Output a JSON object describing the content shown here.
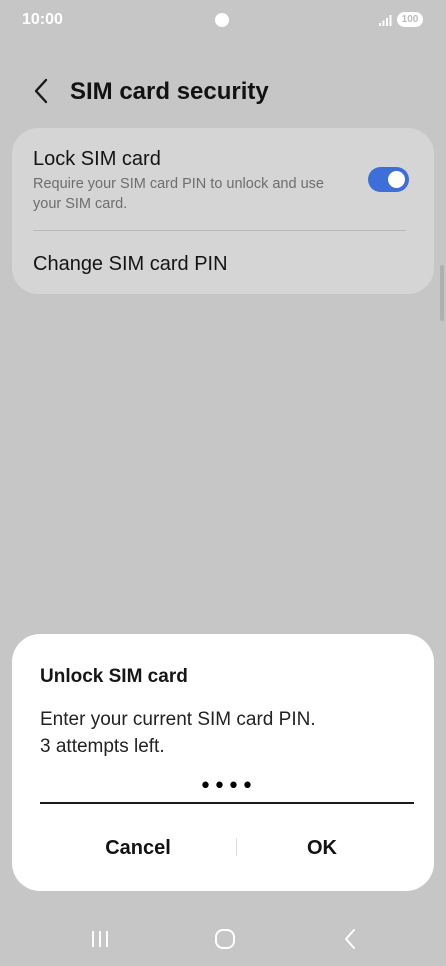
{
  "status_bar": {
    "time": "10:00",
    "battery": "100"
  },
  "header": {
    "title": "SIM card security"
  },
  "settings": {
    "lock_sim": {
      "title": "Lock SIM card",
      "description": "Require your SIM card PIN to unlock and use your SIM card.",
      "enabled": true
    },
    "change_pin": {
      "label": "Change SIM card PIN"
    }
  },
  "dialog": {
    "title": "Unlock SIM card",
    "message_line1": "Enter your current SIM card PIN.",
    "message_line2": "3 attempts left.",
    "pin_value": "••••",
    "cancel_label": "Cancel",
    "ok_label": "OK"
  },
  "colors": {
    "accent": "#3e6fd9",
    "dim_background": "#c6c6c6",
    "card": "#d5d5d5"
  },
  "icons": [
    "back-icon",
    "signal-icon",
    "recents-icon",
    "home-icon",
    "nav-back-icon"
  ]
}
